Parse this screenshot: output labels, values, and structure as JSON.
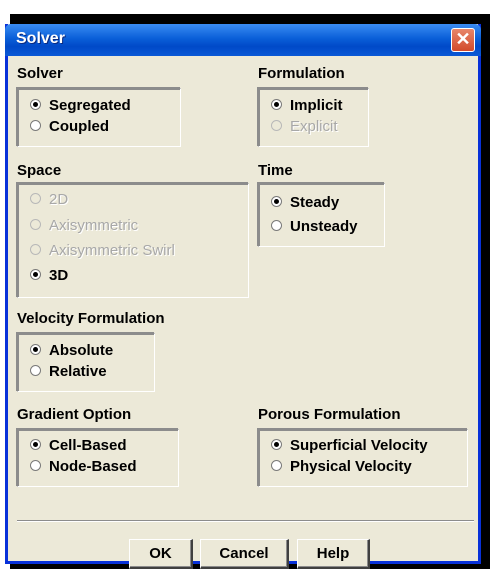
{
  "window": {
    "title": "Solver",
    "close_glyph": "✕"
  },
  "groups": {
    "solver": {
      "label": "Solver",
      "options": [
        {
          "label": "Segregated",
          "selected": true,
          "enabled": true
        },
        {
          "label": "Coupled",
          "selected": false,
          "enabled": true
        }
      ]
    },
    "formulation": {
      "label": "Formulation",
      "options": [
        {
          "label": "Implicit",
          "selected": true,
          "enabled": true
        },
        {
          "label": "Explicit",
          "selected": false,
          "enabled": false
        }
      ]
    },
    "space": {
      "label": "Space",
      "options": [
        {
          "label": "2D",
          "selected": false,
          "enabled": false
        },
        {
          "label": "Axisymmetric",
          "selected": false,
          "enabled": false
        },
        {
          "label": "Axisymmetric Swirl",
          "selected": false,
          "enabled": false
        },
        {
          "label": "3D",
          "selected": true,
          "enabled": true
        }
      ]
    },
    "time": {
      "label": "Time",
      "options": [
        {
          "label": "Steady",
          "selected": true,
          "enabled": true
        },
        {
          "label": "Unsteady",
          "selected": false,
          "enabled": true
        }
      ]
    },
    "velocity_formulation": {
      "label": "Velocity Formulation",
      "options": [
        {
          "label": "Absolute",
          "selected": true,
          "enabled": true
        },
        {
          "label": "Relative",
          "selected": false,
          "enabled": true
        }
      ]
    },
    "gradient_option": {
      "label": "Gradient Option",
      "options": [
        {
          "label": "Cell-Based",
          "selected": true,
          "enabled": true
        },
        {
          "label": "Node-Based",
          "selected": false,
          "enabled": true
        }
      ]
    },
    "porous_formulation": {
      "label": "Porous Formulation",
      "options": [
        {
          "label": "Superficial Velocity",
          "selected": true,
          "enabled": true
        },
        {
          "label": "Physical Velocity",
          "selected": false,
          "enabled": true
        }
      ]
    }
  },
  "buttons": {
    "ok": "OK",
    "cancel": "Cancel",
    "help": "Help"
  }
}
